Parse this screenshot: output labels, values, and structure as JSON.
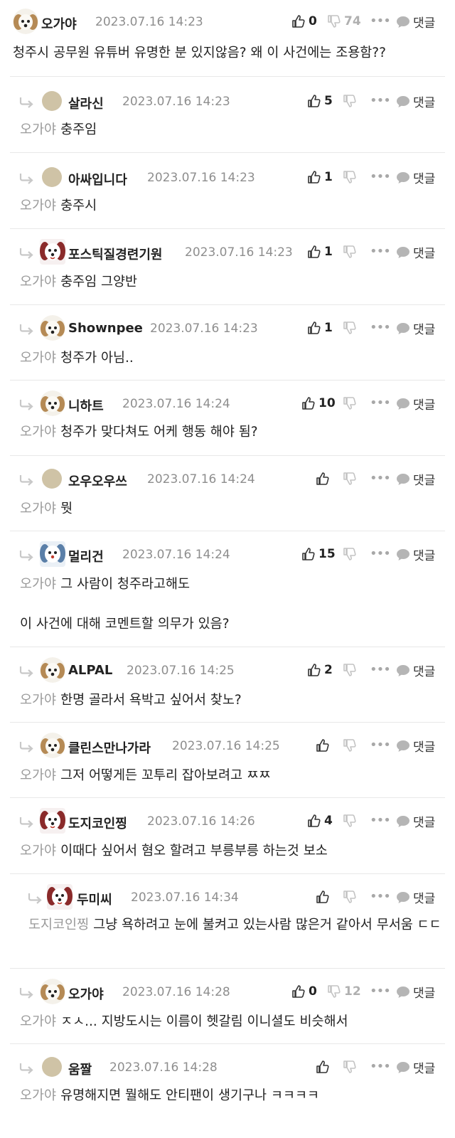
{
  "reply_label": "댓글",
  "comments": [
    {
      "nick": "오가야",
      "date": "2023.07.16 14:23",
      "up": "0",
      "down": "74",
      "body": [
        "청주시 공무원 유튜버 유명한 분 있지않음? 왜 이 사건에는 조용함??"
      ],
      "avatar": "dog-avatar"
    },
    {
      "nick": "살라신",
      "date": "2023.07.16 14:23",
      "up": "5",
      "down": "",
      "mention": "오가야",
      "body": [
        "충주임"
      ],
      "avatar": "default-avatar"
    },
    {
      "nick": "아싸입니다",
      "date": "2023.07.16 14:23",
      "up": "1",
      "down": "",
      "mention": "오가야",
      "body": [
        "충주시"
      ],
      "avatar": "default-avatar"
    },
    {
      "nick": "포스틱질경련기원",
      "date": "2023.07.16 14:23",
      "up": "1",
      "down": "",
      "mention": "오가야",
      "body": [
        "충주임 그양반"
      ],
      "avatar": "red-dog-avatar"
    },
    {
      "nick": "Shownpee",
      "date": "2023.07.16 14:23",
      "up": "1",
      "down": "",
      "mention": "오가야",
      "body": [
        "청주가 아님.."
      ],
      "avatar": "dog-avatar"
    },
    {
      "nick": "니하트",
      "date": "2023.07.16 14:24",
      "up": "10",
      "down": "",
      "mention": "오가야",
      "body": [
        "청주가 맞다쳐도 어케 행동 해야 됨?"
      ],
      "avatar": "dog-avatar"
    },
    {
      "nick": "오우오우쓰",
      "date": "2023.07.16 14:24",
      "up": "",
      "down": "",
      "mention": "오가야",
      "body": [
        "뭣"
      ],
      "avatar": "default-avatar"
    },
    {
      "nick": "멀리건",
      "date": "2023.07.16 14:24",
      "up": "15",
      "down": "",
      "mention": "오가야",
      "body": [
        "그 사람이 청주라고해도",
        "이 사건에 대해 코멘트할 의무가 있음?"
      ],
      "avatar": "blue-dog-avatar"
    },
    {
      "nick": "ALPAL",
      "date": "2023.07.16 14:25",
      "up": "2",
      "down": "",
      "mention": "오가야",
      "body": [
        "한명 골라서 욕박고 싶어서 찾노?"
      ],
      "avatar": "dog-avatar"
    },
    {
      "nick": "클린스만나가라",
      "date": "2023.07.16 14:25",
      "up": "",
      "down": "",
      "mention": "오가야",
      "body": [
        "그저 어떻게든 꼬투리 잡아보려고 ㅉㅉ"
      ],
      "avatar": "dog-avatar"
    },
    {
      "nick": "도지코인찡",
      "date": "2023.07.16 14:26",
      "up": "4",
      "down": "",
      "mention": "오가야",
      "body": [
        "이때다 싶어서 혐오 할려고 부릉부릉 하는것 보소"
      ],
      "avatar": "red-dog-avatar"
    },
    {
      "nick": "두미씨",
      "date": "2023.07.16 14:34",
      "up": "",
      "down": "",
      "mention": "도지코인찡",
      "body": [
        "그냥 욕하려고 눈에 불켜고 있는사람 많은거 같아서 무서움 ㄷㄷ"
      ],
      "avatar": "red-dog-avatar"
    },
    {
      "nick": "오가야",
      "date": "2023.07.16 14:28",
      "up": "0",
      "down": "12",
      "mention": "오가야",
      "body": [
        "ㅈㅅ... 지방도시는 이름이 헷갈림 이니셜도 비슷해서"
      ],
      "avatar": "dog-avatar"
    },
    {
      "nick": "움짤",
      "date": "2023.07.16 14:28",
      "up": "",
      "down": "",
      "mention": "오가야",
      "body": [
        "유명해지면 뭘해도 안티팬이 생기구나 ㅋㅋㅋㅋ"
      ],
      "avatar": "default-avatar"
    }
  ]
}
